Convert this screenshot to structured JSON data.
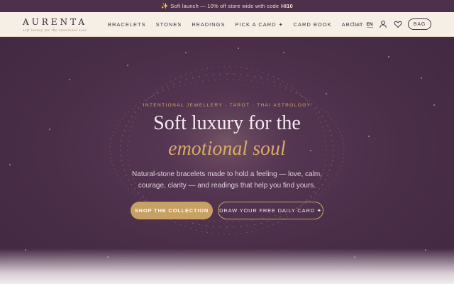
{
  "announcement": {
    "sparkle": "✨",
    "text": "Soft launch — 10% off store wide with code",
    "code": "HI10"
  },
  "brand": {
    "name": "AURENTA",
    "tagline": "soft luxury for the emotional soul"
  },
  "nav": {
    "links": [
      "BRACELETS",
      "STONES",
      "READINGS",
      "PICK A CARD",
      "CARD BOOK",
      "ABOUT"
    ],
    "pick_star": "✦",
    "lang_thai": "ไทย",
    "lang_sep": "·",
    "lang_en": "EN",
    "bag": "BAG",
    "icons": [
      "account-icon",
      "heart-icon"
    ]
  },
  "hero": {
    "eyebrow": "INTENTIONAL JEWELLERY · TAROT · THAI ASTROLOGY",
    "title_line1": "Soft luxury for the",
    "title_line2": "emotional soul",
    "subtitle": "Natural-stone bracelets made to hold a feeling — love, calm, courage, clarity — and readings that help you find yours.",
    "primary_cta": "SHOP THE COLLECTION",
    "secondary_cta": "DRAW YOUR FREE DAILY CARD ✦"
  },
  "colors": {
    "accent_gold": "#c7a063",
    "hero_plum": "#4a2e48",
    "nav_cream": "#f6efe6"
  }
}
